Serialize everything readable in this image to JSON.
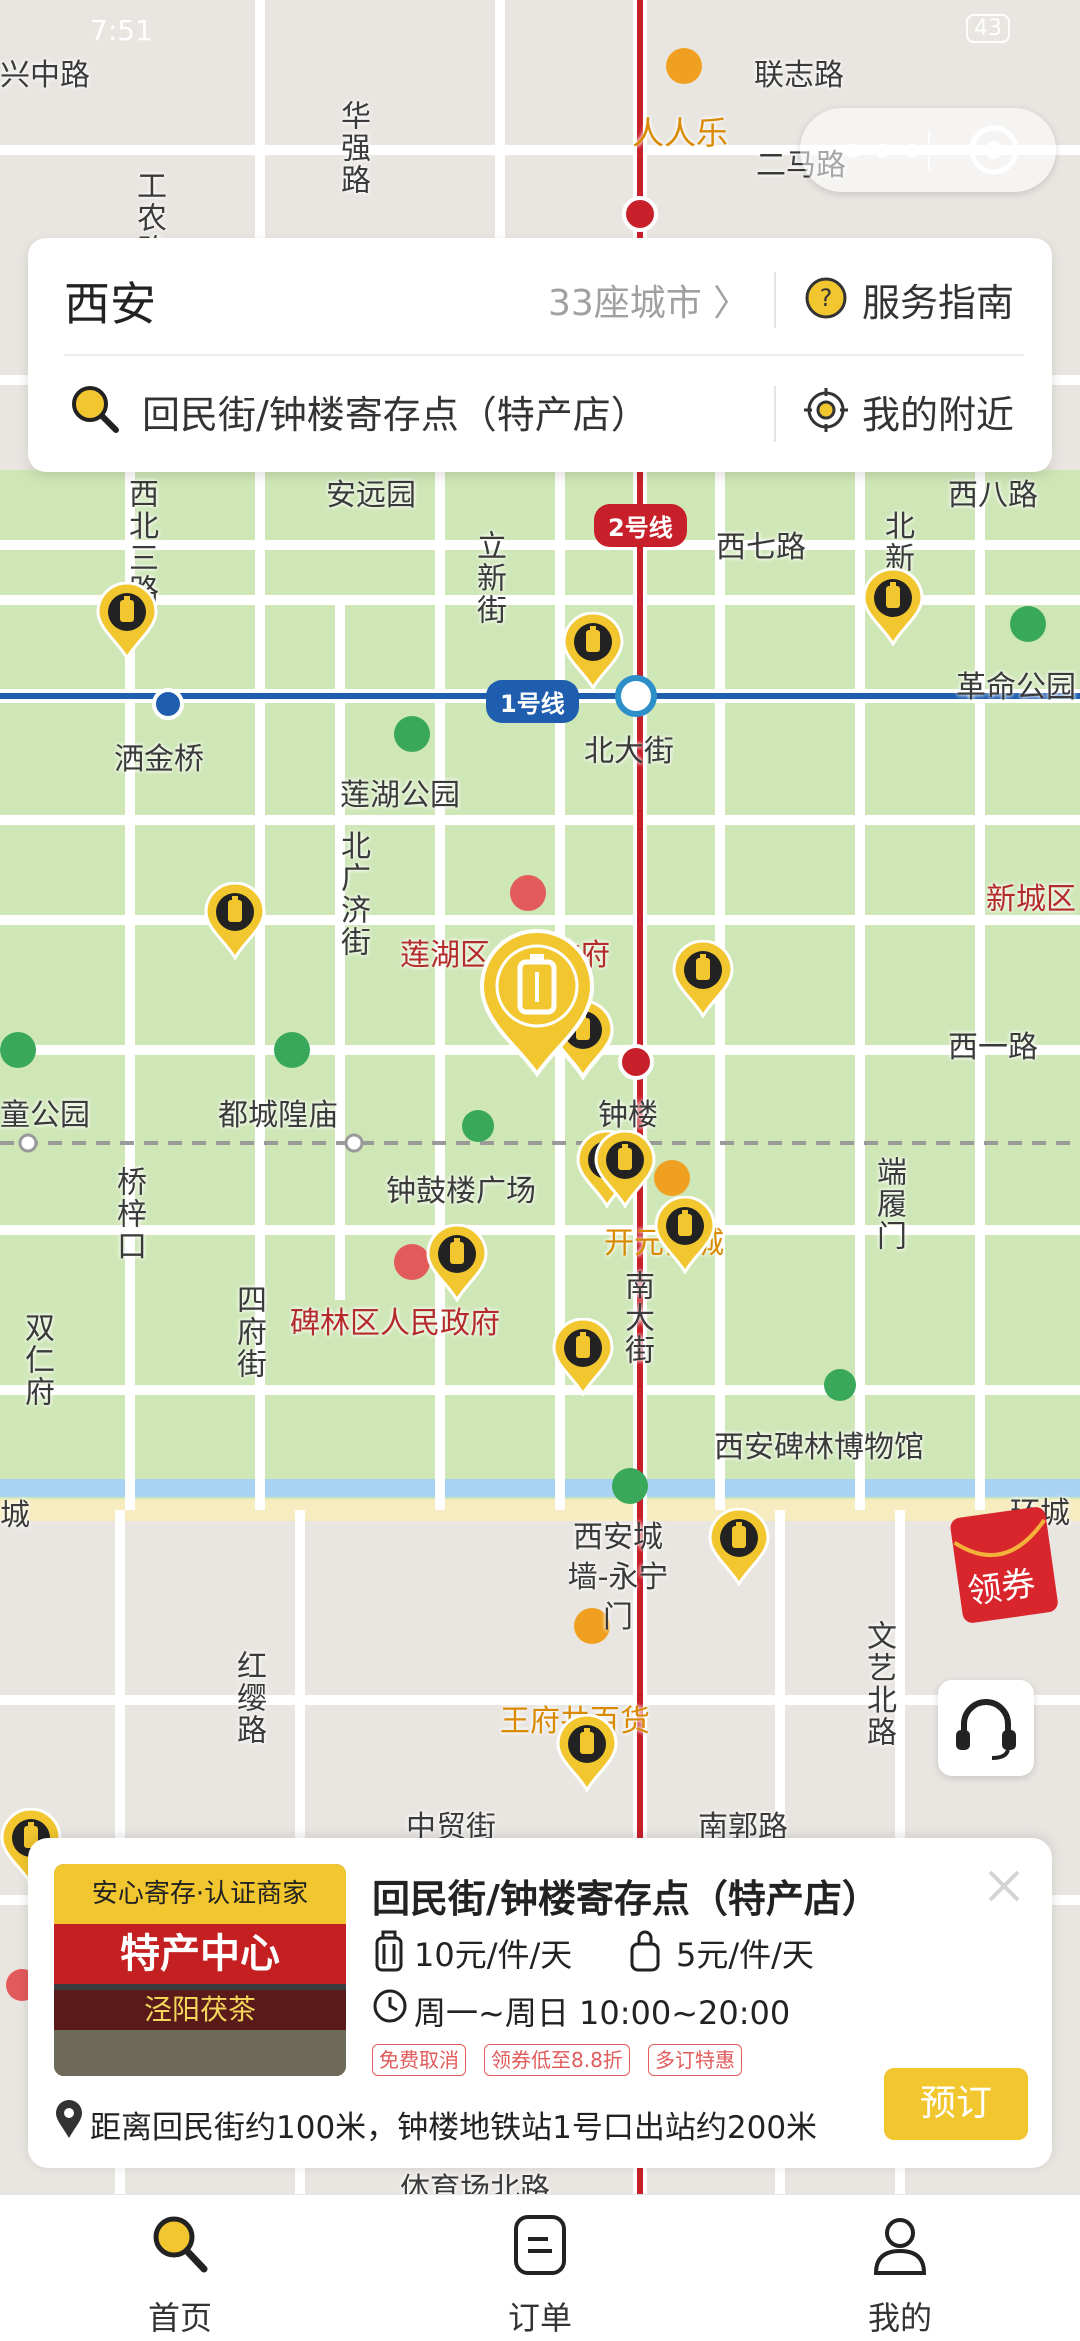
{
  "status_bar": {
    "time": "7:51",
    "battery": "43"
  },
  "map": {
    "roads_labels": [
      "兴中路",
      "华强路",
      "工农路",
      "人人乐",
      "联志路",
      "二马路",
      "安远园",
      "西北三路",
      "立新街",
      "西七路",
      "北新街",
      "西八路",
      "革命公园",
      "洒金桥",
      "北大街",
      "莲湖公园",
      "北广济街",
      "新城区",
      "莲湖区人民政府",
      "西一路",
      "童公园",
      "都城隍庙",
      "钟楼",
      "钟鼓楼广场",
      "开元商城",
      "桥梓口",
      "端履门",
      "四府街",
      "南大街",
      "碑林区人民政府",
      "双仁府",
      "西安碑林博物馆",
      "西安城墙-永宁门",
      "红缨路",
      "王府井百货",
      "文艺北路",
      "中贸街",
      "南郭路",
      "体育场北路",
      "城",
      "环城"
    ],
    "metro_badges": {
      "line1": "1号线",
      "line2": "2号线"
    }
  },
  "top_card": {
    "city": "西安",
    "city_count": "33座城市 〉",
    "guide": "服务指南",
    "search_text": "回民街/钟楼寄存点（特产店）",
    "nearby": "我的附近"
  },
  "coupon": {
    "label": "领券"
  },
  "store": {
    "badge": "安心寄存·认证商家",
    "title": "回民街/钟楼寄存点（特产店）",
    "price_large": "10元/件/天",
    "price_small": "5元/件/天",
    "hours": "周一~周日 10:00~20:00",
    "tags": [
      "免费取消",
      "领券低至8.8折",
      "多订特惠"
    ],
    "distance": "距离回民街约100米，钟楼地铁站1号口出站约200米",
    "book_button": "预订",
    "photo_sign": "特产中心",
    "photo_sign2": "泾阳茯茶"
  },
  "tabbar": {
    "items": [
      {
        "label": "首页",
        "icon": "search-icon"
      },
      {
        "label": "订单",
        "icon": "order-icon"
      },
      {
        "label": "我的",
        "icon": "user-icon"
      }
    ]
  },
  "colors": {
    "accent": "#f2c62f",
    "map_green": "#cfe7b7",
    "metro_red": "#c8202a",
    "metro_blue": "#1f5eae"
  }
}
